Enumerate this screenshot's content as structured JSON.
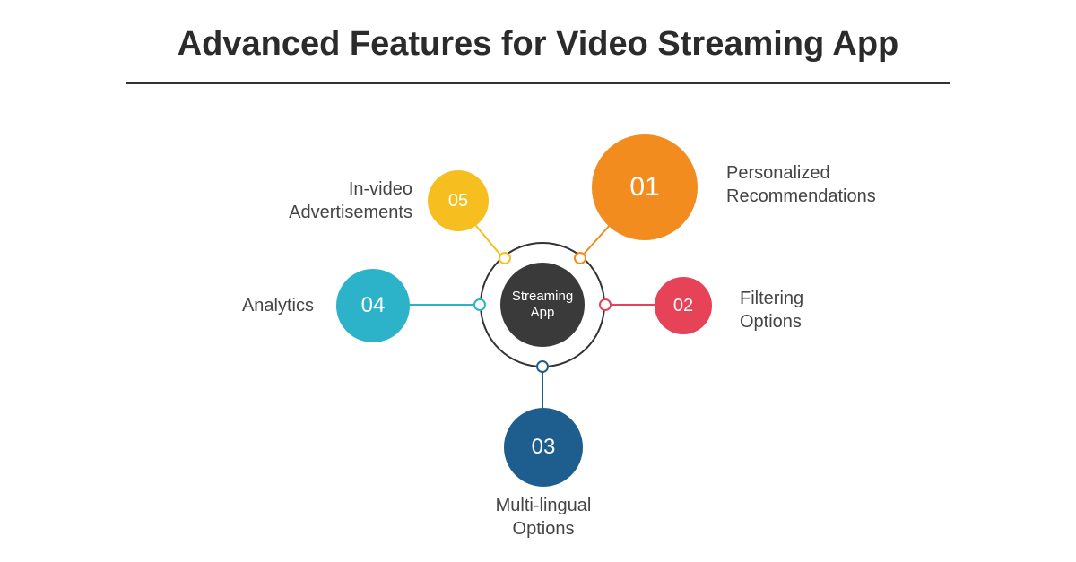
{
  "title": "Advanced Features for Video Streaming App",
  "hub": "Streaming\nApp",
  "features": {
    "f1": {
      "num": "01",
      "label": "Personalized\nRecommendations",
      "color": "#f28c1e"
    },
    "f2": {
      "num": "02",
      "label": "Filtering\nOptions",
      "color": "#e64358"
    },
    "f3": {
      "num": "03",
      "label": "Multi-lingual\nOptions",
      "color": "#1e5e8e"
    },
    "f4": {
      "num": "04",
      "label": "Analytics",
      "color": "#2cb3c9"
    },
    "f5": {
      "num": "05",
      "label": "In-video\nAdvertisements",
      "color": "#f6bf1f"
    }
  }
}
